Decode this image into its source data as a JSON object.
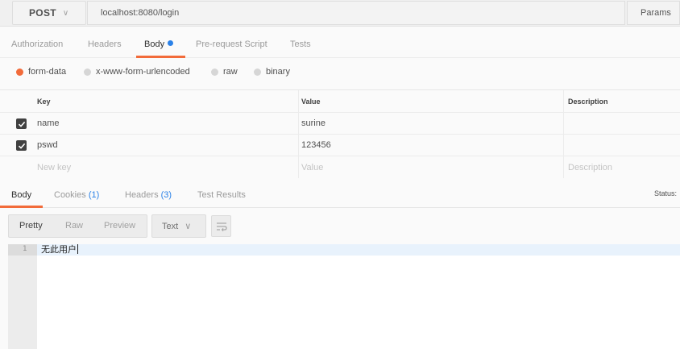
{
  "request": {
    "method": "POST",
    "url": "localhost:8080/login",
    "params_label": "Params"
  },
  "request_tabs": [
    {
      "label": "Authorization"
    },
    {
      "label": "Headers"
    },
    {
      "label": "Body"
    },
    {
      "label": "Pre-request Script"
    },
    {
      "label": "Tests"
    }
  ],
  "body_types": [
    {
      "label": "form-data",
      "selected": true
    },
    {
      "label": "x-www-form-urlencoded",
      "selected": false
    },
    {
      "label": "raw",
      "selected": false
    },
    {
      "label": "binary",
      "selected": false
    }
  ],
  "form_table": {
    "headers": {
      "key": "Key",
      "value": "Value",
      "description": "Description"
    },
    "rows": [
      {
        "checked": true,
        "key": "name",
        "value": "surine",
        "description": ""
      },
      {
        "checked": true,
        "key": "pswd",
        "value": "123456",
        "description": ""
      }
    ],
    "placeholders": {
      "key": "New key",
      "value": "Value",
      "description": "Description"
    }
  },
  "response_tabs": [
    {
      "label": "Body",
      "count": ""
    },
    {
      "label": "Cookies",
      "count": "(1)"
    },
    {
      "label": "Headers",
      "count": "(3)"
    },
    {
      "label": "Test Results",
      "count": ""
    }
  ],
  "status_label": "Status:",
  "view_modes": [
    {
      "label": "Pretty"
    },
    {
      "label": "Raw"
    },
    {
      "label": "Preview"
    }
  ],
  "format": {
    "label": "Text"
  },
  "icons": {
    "method_chevron": "chevron-down-icon",
    "format_chevron": "chevron-down-icon",
    "wrap": "wrap-lines-icon",
    "check": "check-icon"
  },
  "colors": {
    "accent": "#f26b3a",
    "link": "#2b82e8"
  },
  "response_body": {
    "lines": [
      {
        "num": "1",
        "text": "无此用户"
      }
    ]
  }
}
